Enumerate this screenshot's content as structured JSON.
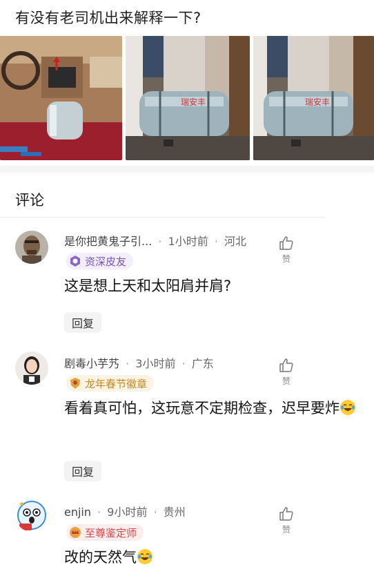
{
  "post": {
    "title": "有没有老司机出来解释一下?"
  },
  "images": [
    {
      "name": "car-interior-gas-tank-photo"
    },
    {
      "name": "gas-cylinder-car-floor-photo-1"
    },
    {
      "name": "gas-cylinder-car-floor-photo-2"
    }
  ],
  "comments_section": {
    "title": "评论"
  },
  "comments": [
    {
      "name": "是你把黄鬼子引...",
      "time": "1小时前",
      "location": "河北",
      "badge": "资深皮友",
      "content": "这是想上天和太阳肩并肩?",
      "reply_label": "回复",
      "like_label": "赞"
    },
    {
      "name": "剧毒小芋艿",
      "time": "3小时前",
      "location": "广东",
      "badge": "龙年春节徽章",
      "content": "看着真可怕，这玩意不定期检查，迟早要炸",
      "reply_label": "回复",
      "like_label": "赞"
    },
    {
      "name": "enjin",
      "time": "9小时前",
      "location": "贵州",
      "badge": "至尊鉴定师",
      "content": "改的天然气",
      "like_label": "赞"
    }
  ],
  "icons": {
    "like": "thumbs-up-icon",
    "emoji": "laughing-crying-emoji"
  },
  "colors": {
    "badge_purple": "#7a55b8",
    "badge_gold": "#c88a1e",
    "badge_red": "#d24747"
  }
}
